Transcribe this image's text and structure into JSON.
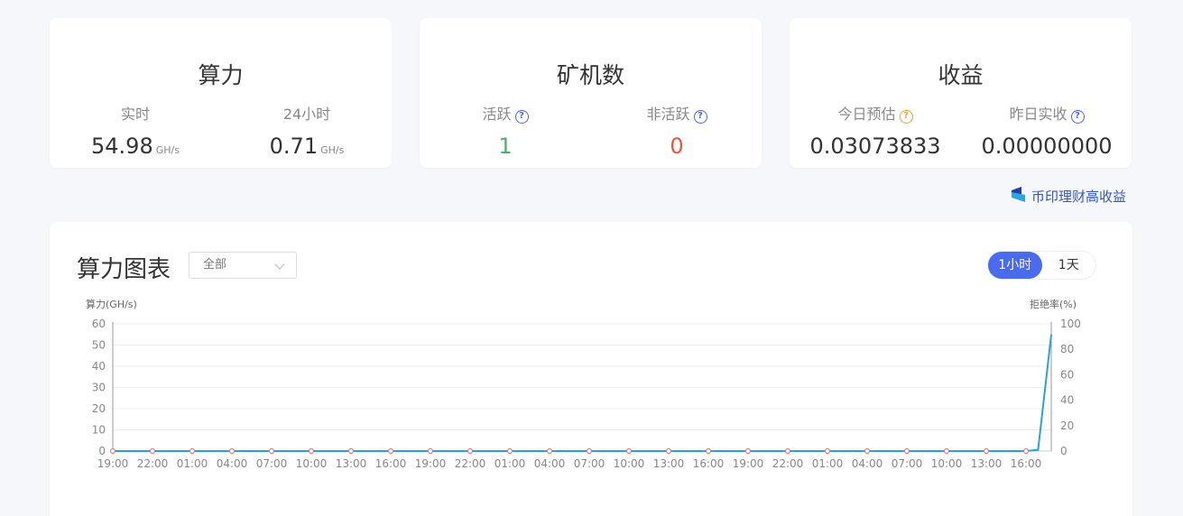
{
  "hashrate_card": {
    "title": "算力",
    "realtime_label": "实时",
    "realtime_value": "54.98",
    "realtime_unit": "GH/s",
    "day_label": "24小时",
    "day_value": "0.71",
    "day_unit": "GH/s"
  },
  "miners_card": {
    "title": "矿机数",
    "active_label": "活跃",
    "active_value": "1",
    "inactive_label": "非活跃",
    "inactive_value": "0",
    "help_glyph": "?"
  },
  "earnings_card": {
    "title": "收益",
    "today_label": "今日预估",
    "today_value": "0.03073833",
    "yesterday_label": "昨日实收",
    "yesterday_value": "0.00000000",
    "help_glyph": "?"
  },
  "promo": {
    "label": "币印理财高收益",
    "icon": "wallet-logo-icon",
    "color": "#3556c8"
  },
  "chart_card": {
    "title": "算力图表",
    "select_value": "全部",
    "toggle": [
      "1小时",
      "1天"
    ],
    "toggle_active": "1小时",
    "accent": "#4a6bf0"
  },
  "chart_data": {
    "type": "line",
    "ylabel": "算力(GH/s)",
    "y2label": "拒绝率(%)",
    "ylim": [
      0,
      60
    ],
    "y2lim": [
      0,
      100
    ],
    "yticks": [
      0,
      10,
      20,
      30,
      40,
      50,
      60
    ],
    "y2ticks": [
      0,
      20,
      40,
      60,
      80,
      100
    ],
    "x_tick_labels": [
      "19:00",
      "22:00",
      "01:00",
      "04:00",
      "07:00",
      "10:00",
      "13:00",
      "16:00",
      "19:00",
      "22:00",
      "01:00",
      "04:00",
      "07:00",
      "10:00",
      "13:00",
      "16:00",
      "19:00",
      "22:00",
      "01:00",
      "04:00",
      "07:00",
      "10:00",
      "13:00",
      "16:00"
    ],
    "grid": true,
    "series": [
      {
        "name": "",
        "axis": "left",
        "color": "#29a3d8",
        "values": [
          0,
          0,
          0,
          0,
          0,
          0,
          0,
          0,
          0,
          0,
          0,
          0,
          0,
          0,
          0,
          0,
          0,
          0,
          0,
          0,
          0,
          0,
          0,
          0,
          0,
          0,
          0,
          0,
          0,
          0,
          0,
          0,
          0,
          0,
          0,
          0,
          0,
          0,
          0,
          0,
          0,
          0,
          0,
          0,
          0,
          0,
          0,
          0,
          0,
          0,
          0,
          0,
          0,
          0,
          0,
          0,
          0,
          0,
          0,
          0,
          0,
          0,
          0,
          0,
          0,
          0,
          0,
          0,
          0,
          0,
          0.5,
          54.98
        ]
      },
      {
        "name": "",
        "axis": "right",
        "color": "#e87c86",
        "values": [
          0,
          0,
          0,
          0,
          0,
          0,
          0,
          0,
          0,
          0,
          0,
          0,
          0,
          0,
          0,
          0,
          0,
          0,
          0,
          0,
          0,
          0,
          0,
          0
        ]
      }
    ]
  }
}
